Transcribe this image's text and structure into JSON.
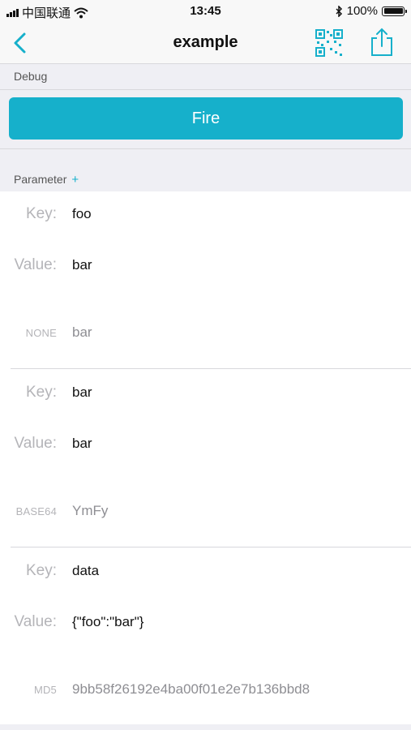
{
  "status": {
    "carrier": "中国联通",
    "time": "13:45",
    "battery": "100%",
    "battery_level": 1.0
  },
  "nav": {
    "title": "example"
  },
  "debug": {
    "label": "Debug",
    "fire_label": "Fire"
  },
  "parameter": {
    "label": "Parameter",
    "add_symbol": "+"
  },
  "params": [
    {
      "key_label": "Key:",
      "key": "foo",
      "value_label": "Value:",
      "value": "bar",
      "encoding": "NONE",
      "encoded": "bar"
    },
    {
      "key_label": "Key:",
      "key": "bar",
      "value_label": "Value:",
      "value": "bar",
      "encoding": "BASE64",
      "encoded": "YmFy"
    },
    {
      "key_label": "Key:",
      "key": "data",
      "value_label": "Value:",
      "value": "{\"foo\":\"bar\"}",
      "encoding": "MD5",
      "encoded": "9bb58f26192e4ba00f01e2e7b136bbd8"
    }
  ],
  "colors": {
    "accent": "#16b0cb",
    "section_bg": "#efeff4",
    "label_gray": "#b4b4b8"
  }
}
